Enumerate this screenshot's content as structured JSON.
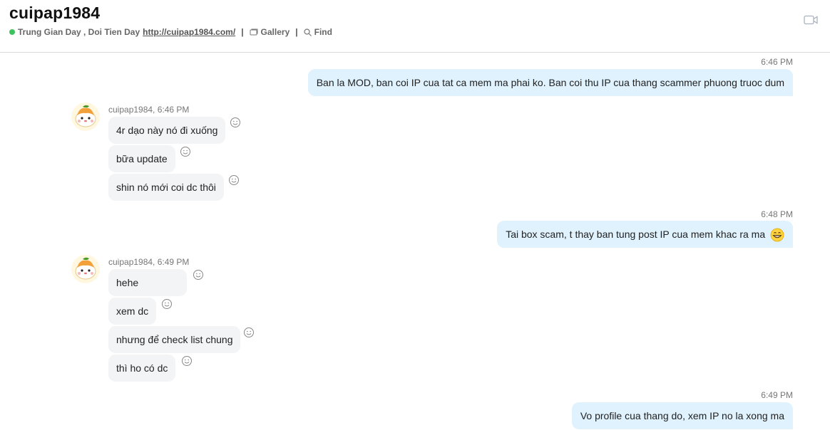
{
  "header": {
    "title": "cuipap1984",
    "status_text": "Trung Gian Day , Doi Tien Day",
    "link": "http://cuipap1984.com/",
    "separator": "|",
    "gallery_label": "Gallery",
    "find_label": "Find"
  },
  "messages": {
    "out1": {
      "time": "6:46 PM",
      "text": "Ban la MOD, ban coi IP cua tat ca mem ma phai ko. Ban coi thu IP cua thang scammer phuong truoc dum"
    },
    "group1": {
      "sender": "cuipap1984, 6:46 PM",
      "items": [
        "4r dạo này nó đi xuống",
        "bữa update",
        "shin nó mới coi dc thôi"
      ]
    },
    "out2": {
      "time": "6:48 PM",
      "text": "Tai box scam, t thay ban tung post IP cua mem khac ra ma",
      "emoji": "grin-emoji"
    },
    "group2": {
      "sender": "cuipap1984, 6:49 PM",
      "items": [
        "hehe",
        "xem dc",
        "nhưng để check list chung",
        "thì ho có dc"
      ]
    },
    "out3": {
      "time": "6:49 PM",
      "text": "Vo profile cua thang do, xem IP no la xong ma"
    }
  },
  "colors": {
    "online": "#3cc35e",
    "outgoing_bubble": "#dff2fd",
    "incoming_bubble": "#f3f4f6"
  }
}
